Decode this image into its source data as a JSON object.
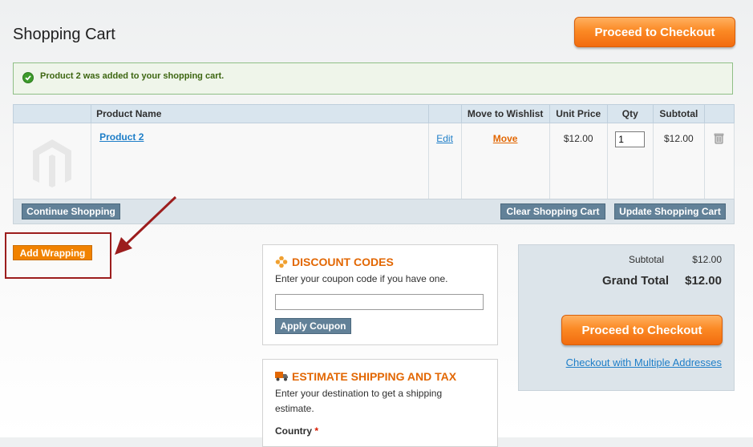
{
  "page": {
    "title": "Shopping Cart"
  },
  "top_checkout_label": "Proceed to Checkout",
  "message": "Product 2 was added to your shopping cart.",
  "table": {
    "headers": {
      "name": "Product Name",
      "wishlist": "Move to Wishlist",
      "unit_price": "Unit Price",
      "qty": "Qty",
      "subtotal": "Subtotal"
    },
    "rows": [
      {
        "name": "Product 2",
        "edit": "Edit",
        "move": "Move",
        "unit_price": "$12.00",
        "qty": "1",
        "subtotal": "$12.00"
      }
    ]
  },
  "actions": {
    "continue": "Continue Shopping",
    "clear": "Clear Shopping Cart",
    "update": "Update Shopping Cart"
  },
  "add_wrapping": "Add Wrapping",
  "discount": {
    "title": "DISCOUNT CODES",
    "text": "Enter your coupon code if you have one.",
    "input_value": "",
    "button": "Apply Coupon"
  },
  "shipping": {
    "title": "ESTIMATE SHIPPING AND TAX",
    "text": "Enter your destination to get a shipping estimate.",
    "country_label": "Country",
    "required_mark": "*"
  },
  "totals": {
    "subtotal_label": "Subtotal",
    "subtotal_value": "$12.00",
    "grand_label": "Grand Total",
    "grand_value": "$12.00",
    "checkout_label": "Proceed to Checkout",
    "multi_link": "Checkout with Multiple Addresses"
  },
  "colors": {
    "accent": "#f26c0f",
    "link": "#1e7ec8",
    "heading_orange": "#e26703",
    "annotation": "#9c1d1d"
  }
}
